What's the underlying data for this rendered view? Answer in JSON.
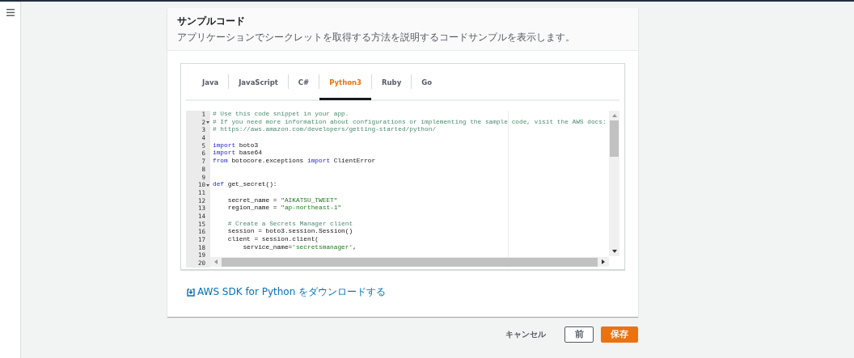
{
  "panel": {
    "title": "サンプルコード",
    "description": "アプリケーションでシークレットを取得する方法を説明するコードサンプルを表示します。"
  },
  "tabs": [
    {
      "label": "Java",
      "selected": false
    },
    {
      "label": "JavaScript",
      "selected": false
    },
    {
      "label": "C#",
      "selected": false
    },
    {
      "label": "Python3",
      "selected": true
    },
    {
      "label": "Ruby",
      "selected": false
    },
    {
      "label": "Go",
      "selected": false
    }
  ],
  "code_lines": [
    {
      "number": "1",
      "foldable": false,
      "tokens": [
        {
          "kind": "comment",
          "text": "# Use this code snippet in your app."
        }
      ]
    },
    {
      "number": "2",
      "foldable": true,
      "tokens": [
        {
          "kind": "comment",
          "text": "# If you need more information about configurations or implementing the sample code, visit the AWS docs:"
        }
      ]
    },
    {
      "number": "3",
      "foldable": false,
      "tokens": [
        {
          "kind": "comment",
          "text": "# https://aws.amazon.com/developers/getting-started/python/"
        }
      ]
    },
    {
      "number": "4",
      "foldable": false
    },
    {
      "number": "5",
      "foldable": false,
      "tokens": [
        {
          "kind": "keyword",
          "text": "import"
        },
        {
          "kind": "plain",
          "text": " boto3"
        }
      ]
    },
    {
      "number": "6",
      "foldable": false,
      "tokens": [
        {
          "kind": "keyword",
          "text": "import"
        },
        {
          "kind": "plain",
          "text": " base64"
        }
      ]
    },
    {
      "number": "7",
      "foldable": false,
      "tokens": [
        {
          "kind": "keyword",
          "text": "from"
        },
        {
          "kind": "plain",
          "text": " botocore.exceptions "
        },
        {
          "kind": "keyword",
          "text": "import"
        },
        {
          "kind": "plain",
          "text": " ClientError"
        }
      ]
    },
    {
      "number": "8",
      "foldable": false
    },
    {
      "number": "9",
      "foldable": false
    },
    {
      "number": "10",
      "foldable": true,
      "tokens": [
        {
          "kind": "keyword",
          "text": "def"
        },
        {
          "kind": "plain",
          "text": " get_secret():"
        }
      ]
    },
    {
      "number": "11",
      "foldable": false
    },
    {
      "number": "12",
      "foldable": false,
      "tokens": [
        {
          "kind": "plain",
          "text": "    secret_name = "
        },
        {
          "kind": "string",
          "text": "\"AIKATSU_TWEET\""
        }
      ]
    },
    {
      "number": "13",
      "foldable": false,
      "tokens": [
        {
          "kind": "plain",
          "text": "    region_name = "
        },
        {
          "kind": "string",
          "text": "\"ap-northeast-1\""
        }
      ]
    },
    {
      "number": "14",
      "foldable": false
    },
    {
      "number": "15",
      "foldable": false,
      "tokens": [
        {
          "kind": "comment",
          "text": "    # Create a Secrets Manager client"
        }
      ]
    },
    {
      "number": "16",
      "foldable": false,
      "tokens": [
        {
          "kind": "plain",
          "text": "    session = boto3.session.Session()"
        }
      ]
    },
    {
      "number": "17",
      "foldable": false,
      "tokens": [
        {
          "kind": "plain",
          "text": "    client = session.client("
        }
      ]
    },
    {
      "number": "18",
      "foldable": false,
      "tokens": [
        {
          "kind": "plain",
          "text": "        service_name="
        },
        {
          "kind": "string",
          "text": "'secretsmanager'"
        },
        {
          "kind": "plain",
          "text": ","
        }
      ]
    },
    {
      "number": "19",
      "foldable": false
    },
    {
      "number": "20",
      "foldable": false
    }
  ],
  "download_link": "AWS SDK for Python をダウンロードする",
  "buttons": {
    "cancel": "キャンセル",
    "previous": "前",
    "save": "保存"
  }
}
